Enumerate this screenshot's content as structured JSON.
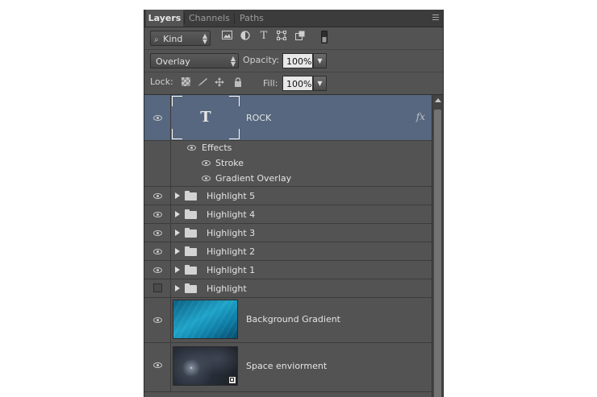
{
  "tabs": [
    {
      "label": "Layers",
      "active": true
    },
    {
      "label": "Channels",
      "active": false
    },
    {
      "label": "Paths",
      "active": false
    }
  ],
  "filter": {
    "kind_label": "Kind",
    "icons": [
      "pixel-filter-icon",
      "adjustment-filter-icon",
      "type-filter-icon",
      "shape-filter-icon",
      "smart-object-filter-icon",
      "filter-toggle-icon"
    ]
  },
  "blend": {
    "mode": "Overlay",
    "opacity_label": "Opacity:",
    "opacity_value": "100%"
  },
  "lock": {
    "label": "Lock:",
    "icons": [
      "lock-transparent-icon",
      "lock-image-icon",
      "lock-position-icon",
      "lock-all-icon"
    ],
    "fill_label": "Fill:",
    "fill_value": "100%"
  },
  "layers": {
    "rock": {
      "name": "ROCK",
      "thumb_glyph": "T",
      "fx": "fx",
      "effects_label": "Effects",
      "effect_items": [
        "Stroke",
        "Gradient Overlay"
      ]
    },
    "groups": [
      "Highlight 5",
      "Highlight 4",
      "Highlight 3",
      "Highlight 2",
      "Highlight 1",
      "Highlight"
    ],
    "background": {
      "name": "Background Gradient"
    },
    "space": {
      "name": "Space enviorment"
    }
  },
  "colors": {
    "panel_bg": "#535353",
    "selected_layer": "#56677f",
    "gradient_thumb": "#1ea3c8"
  }
}
